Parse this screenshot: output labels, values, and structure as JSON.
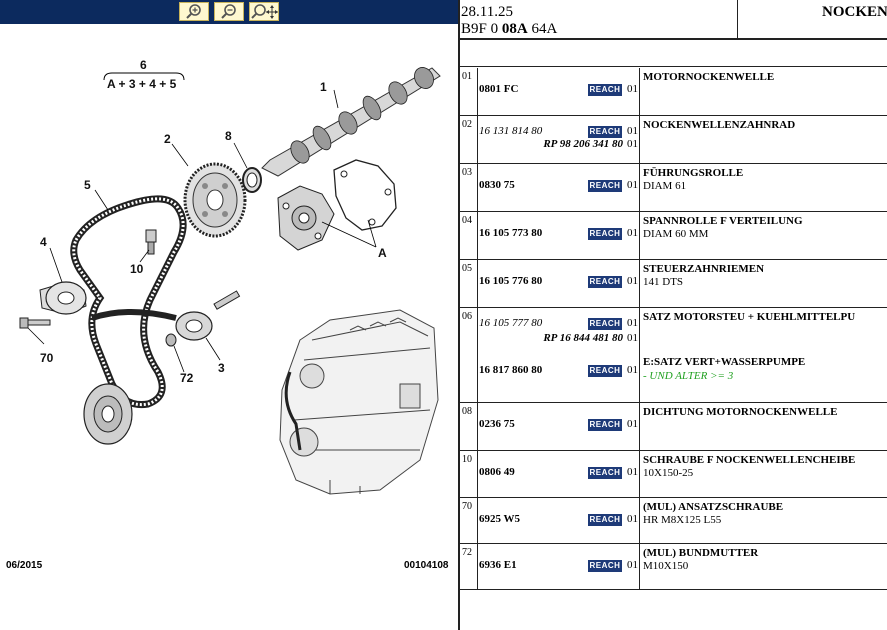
{
  "toolbar": {
    "zoom_in_icon": "zoom-in-icon",
    "zoom_out_icon": "zoom-out-icon",
    "zoom_fit_icon": "zoom-fit-icon",
    "color": "#0c2a5e"
  },
  "diagram": {
    "group_label": "6",
    "group_formula": "A + 3 + 4 + 5",
    "callouts": {
      "c1": "1",
      "c2": "2",
      "c8": "8",
      "c5": "5",
      "c4": "4",
      "c10": "10",
      "cA": "A",
      "c70": "70",
      "c72": "72",
      "c3": "3"
    },
    "footer_date": "06/2015",
    "footer_ref": "00104108"
  },
  "header": {
    "date": "28.11.25",
    "code_prefix": "B9F 0",
    "code_bold": "08A",
    "code_suffix": "64A",
    "title": "NOCKEN"
  },
  "reach_label": "REACH",
  "rows": [
    {
      "pos": "01",
      "lines": [
        {
          "pn": "0801 FC",
          "italic": false,
          "reach": true,
          "qty": "01"
        }
      ],
      "desc": [
        {
          "text": "MOTORNOCKENWELLE",
          "bold": true
        }
      ]
    },
    {
      "pos": "02",
      "lines": [
        {
          "pn": "16 131 814 80",
          "italic": true,
          "reach": true,
          "qty": "01"
        },
        {
          "rp": "RP 98 206 341 80",
          "qty": "01"
        }
      ],
      "desc": [
        {
          "text": "NOCKENWELLENZAHNRAD",
          "bold": true
        }
      ]
    },
    {
      "pos": "03",
      "lines": [
        {
          "pn": "0830 75",
          "italic": false,
          "reach": true,
          "qty": "01"
        }
      ],
      "desc": [
        {
          "text": "FÜHRUNGSROLLE",
          "bold": true
        },
        {
          "text": "DIAM 61",
          "bold": false
        }
      ]
    },
    {
      "pos": "04",
      "lines": [
        {
          "pn": "16 105 773 80",
          "italic": false,
          "reach": true,
          "qty": "01"
        }
      ],
      "desc": [
        {
          "text": "SPANNROLLE F VERTEILUNG",
          "bold": true
        },
        {
          "text": "DIAM 60 MM",
          "bold": false
        }
      ]
    },
    {
      "pos": "05",
      "lines": [
        {
          "pn": "16 105 776 80",
          "italic": false,
          "reach": true,
          "qty": "01"
        }
      ],
      "desc": [
        {
          "text": "STEUERZAHNRIEMEN",
          "bold": true
        },
        {
          "text": "141 DTS",
          "bold": false
        }
      ]
    },
    {
      "pos": "06",
      "lines": [
        {
          "pn": "16 105 777 80",
          "italic": true,
          "reach": true,
          "qty": "01"
        },
        {
          "rp": "RP 16 844 481 80",
          "qty": "01"
        },
        {
          "pn": "16 817 860 80",
          "italic": false,
          "reach": true,
          "qty": "01"
        }
      ],
      "desc": [
        {
          "text": "SATZ MOTORSTEU + KUEHLMITTELPU",
          "bold": true
        },
        {
          "text": "E:SATZ VERT+WASSERPUMPE",
          "bold": true
        },
        {
          "text": "- UND ALTER >= 3",
          "bold": false,
          "green": true
        }
      ]
    },
    {
      "pos": "08",
      "lines": [
        {
          "pn": "0236 75",
          "italic": false,
          "reach": true,
          "qty": "01"
        }
      ],
      "desc": [
        {
          "text": "DICHTUNG MOTORNOCKENWELLE",
          "bold": true
        }
      ]
    },
    {
      "pos": "10",
      "lines": [
        {
          "pn": "0806 49",
          "italic": false,
          "reach": true,
          "qty": "01"
        }
      ],
      "desc": [
        {
          "text": "SCHRAUBE F NOCKENWELLENCHEIBE",
          "bold": true
        },
        {
          "text": "10X150-25",
          "bold": false
        }
      ]
    },
    {
      "pos": "70",
      "lines": [
        {
          "pn": "6925 W5",
          "italic": false,
          "reach": true,
          "qty": "01"
        }
      ],
      "desc": [
        {
          "text": "(MUL) ANSATZSCHRAUBE",
          "bold": true
        },
        {
          "text": "HR M8X125 L55",
          "bold": false
        }
      ]
    },
    {
      "pos": "72",
      "lines": [
        {
          "pn": "6936 E1",
          "italic": false,
          "reach": true,
          "qty": "01"
        }
      ],
      "desc": [
        {
          "text": "(MUL) BUNDMUTTER",
          "bold": true
        },
        {
          "text": "M10X150",
          "bold": false
        }
      ]
    }
  ],
  "colors": {
    "reach_badge": "#1e3a78",
    "green_note": "#20a020"
  }
}
